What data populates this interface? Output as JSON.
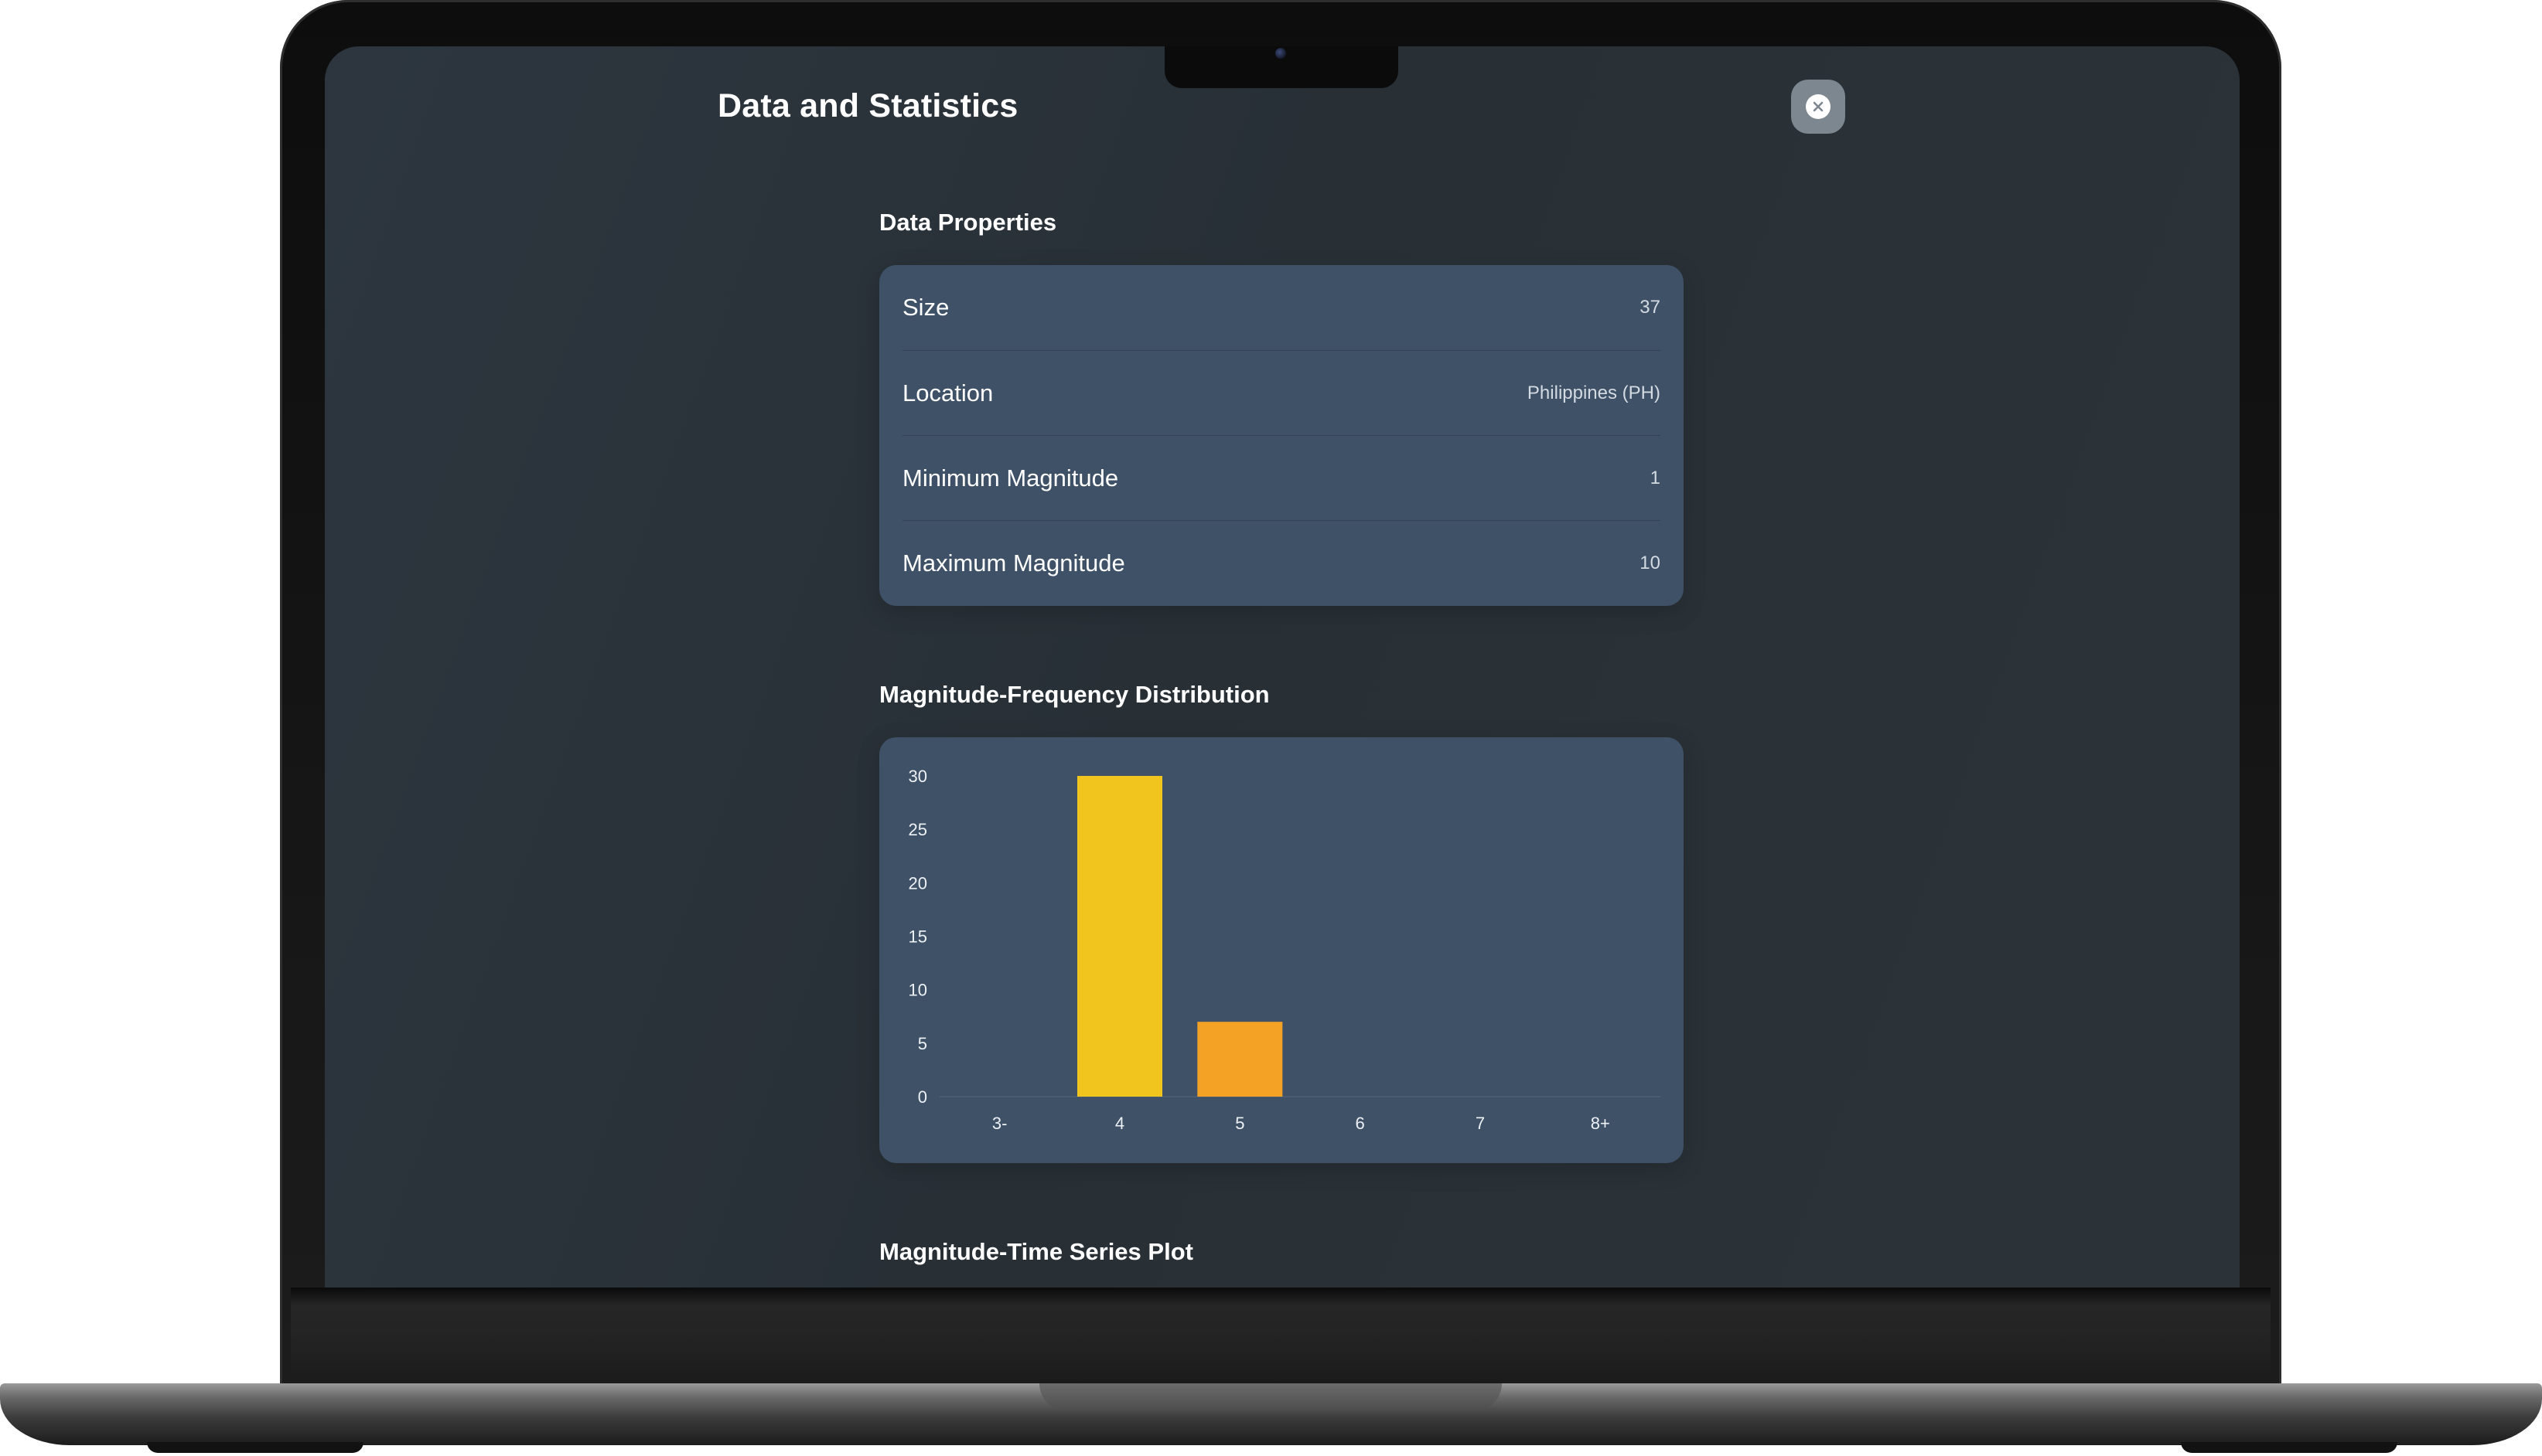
{
  "window": {
    "title": "Data and Statistics"
  },
  "close_button": {
    "icon": "close-icon"
  },
  "data_properties": {
    "title": "Data Properties",
    "rows": [
      {
        "label": "Size",
        "value": "37"
      },
      {
        "label": "Location",
        "value": "Philippines (PH)"
      },
      {
        "label": "Minimum Magnitude",
        "value": "1"
      },
      {
        "label": "Maximum Magnitude",
        "value": "10"
      }
    ]
  },
  "distribution": {
    "title": "Magnitude-Frequency Distribution"
  },
  "time_series": {
    "title": "Magnitude-Time Series Plot"
  },
  "colors": {
    "card": "#3e5167",
    "bar_4": "#f1c51e",
    "bar_5": "#f4a226",
    "close_button": "#7d8790"
  },
  "chart_data": {
    "type": "bar",
    "title": "Magnitude-Frequency Distribution",
    "xlabel": "",
    "ylabel": "",
    "categories": [
      "3-",
      "4",
      "5",
      "6",
      "7",
      "8+"
    ],
    "values": [
      0,
      30,
      7,
      0,
      0,
      0
    ],
    "bar_colors": [
      "#f1c51e",
      "#f1c51e",
      "#f4a226",
      "#f1c51e",
      "#f1c51e",
      "#f1c51e"
    ],
    "yticks": [
      0,
      5,
      10,
      15,
      20,
      25,
      30
    ],
    "ylim": [
      0,
      30
    ],
    "grid": false,
    "legend": "none"
  }
}
